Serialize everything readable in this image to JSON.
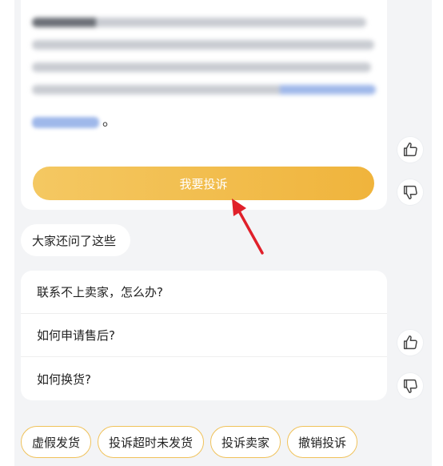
{
  "answer": {
    "complain_button": "我要投诉",
    "link_period": "。"
  },
  "feedback": {
    "like_icon": "thumbs-up-icon",
    "dislike_icon": "thumbs-down-icon"
  },
  "faq": {
    "heading": "大家还问了这些",
    "questions": [
      "联系不上卖家，怎么办?",
      "如何申请售后?",
      "如何换货?"
    ]
  },
  "quick_chips": [
    "虚假发货",
    "投诉超时未发货",
    "投诉卖家",
    "撤销投诉"
  ],
  "colors": {
    "accent_gradient_start": "#f4c862",
    "accent_gradient_end": "#f0b43c",
    "chip_border": "#f0c25a",
    "annotation_arrow": "#e0202a",
    "background": "#f3f4f6"
  }
}
